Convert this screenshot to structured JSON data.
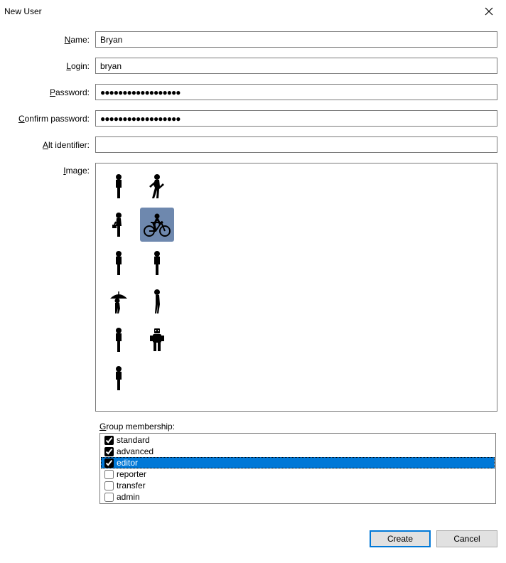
{
  "titlebar": {
    "title": "New User"
  },
  "labels": {
    "name": "ame:",
    "login": "ogin:",
    "password": "assword:",
    "confirm": "onfirm password:",
    "altid": "lt identifier:",
    "image": "mage:",
    "group": "roup membership:"
  },
  "access": {
    "name": "N",
    "login": "L",
    "password": "P",
    "confirm": "C",
    "altid": "A",
    "image": "I",
    "group": "G"
  },
  "fields": {
    "name": "Bryan",
    "login": "bryan",
    "password": "●●●●●●●●●●●●●●●●●●",
    "confirm": "●●●●●●●●●●●●●●●●●●",
    "altid": ""
  },
  "images": [
    {
      "name": "person-standing",
      "selected": false
    },
    {
      "name": "person-walking",
      "selected": false
    },
    {
      "name": "person-briefcase",
      "selected": false
    },
    {
      "name": "person-bicycle",
      "selected": true
    },
    {
      "name": "person-standing-2",
      "selected": false
    },
    {
      "name": "person-standing-3",
      "selected": false
    },
    {
      "name": "person-umbrella",
      "selected": false
    },
    {
      "name": "person-side",
      "selected": false
    },
    {
      "name": "person-standing-4",
      "selected": false
    },
    {
      "name": "robot",
      "selected": false
    },
    {
      "name": "person-standing-5",
      "selected": false
    }
  ],
  "groups": [
    {
      "name": "standard",
      "checked": true,
      "selected": false
    },
    {
      "name": "advanced",
      "checked": true,
      "selected": false
    },
    {
      "name": "editor",
      "checked": true,
      "selected": true
    },
    {
      "name": "reporter",
      "checked": false,
      "selected": false
    },
    {
      "name": "transfer",
      "checked": false,
      "selected": false
    },
    {
      "name": "admin",
      "checked": false,
      "selected": false
    }
  ],
  "buttons": {
    "create": "Create",
    "cancel": "Cancel"
  }
}
